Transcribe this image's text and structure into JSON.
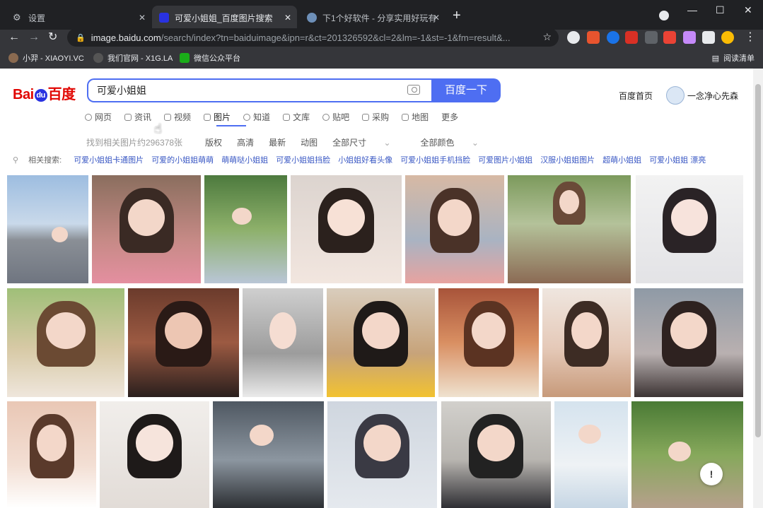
{
  "browser": {
    "tabs": [
      {
        "title": "设置",
        "icon": "gear-icon"
      },
      {
        "title": "可爱小姐姐_百度图片搜索",
        "icon": "baidu-paw-icon"
      },
      {
        "title": "下1个好软件 - 分享实用好玩有趣",
        "icon": "site-icon"
      }
    ],
    "new_tab": "+",
    "url_host": "image.baidu.com",
    "url_rest": "/search/index?tn=baiduimage&ipn=r&ct=201326592&cl=2&lm=-1&st=-1&fm=result&...",
    "bookmarks": [
      {
        "label": "小羿 - XIAOYI.VC"
      },
      {
        "label": "我们官网 - X1G.LA"
      },
      {
        "label": "微信公众平台"
      }
    ],
    "reading_list": "阅读清单"
  },
  "header": {
    "logo_text_a": "Bai",
    "logo_paw": "du",
    "logo_text_b": "百度",
    "search_value": "可爱小姐姐",
    "search_button": "百度一下",
    "home_link": "百度首页",
    "username": "一念净心先森"
  },
  "nav": {
    "tabs": [
      "网页",
      "资讯",
      "视频",
      "图片",
      "知道",
      "文库",
      "贴吧",
      "采购",
      "地图",
      "更多"
    ],
    "active": "图片"
  },
  "filters": {
    "found": "找到相关图片约296378张",
    "items": [
      "版权",
      "高清",
      "最新",
      "动图",
      "全部尺寸",
      "全部颜色"
    ]
  },
  "related": {
    "label": "相关搜索:",
    "items": [
      "可爱小姐姐卡通图片",
      "可爱的小姐姐萌萌",
      "萌萌哒小姐姐",
      "可爱小姐姐挡脸",
      "小姐姐好看头像",
      "可爱小姐姐手机挡脸",
      "可爱图片小姐姐",
      "汉服小姐姐图片",
      "超萌小姐姐",
      "可爱小姐姐 漂亮"
    ]
  },
  "feedback": "!"
}
